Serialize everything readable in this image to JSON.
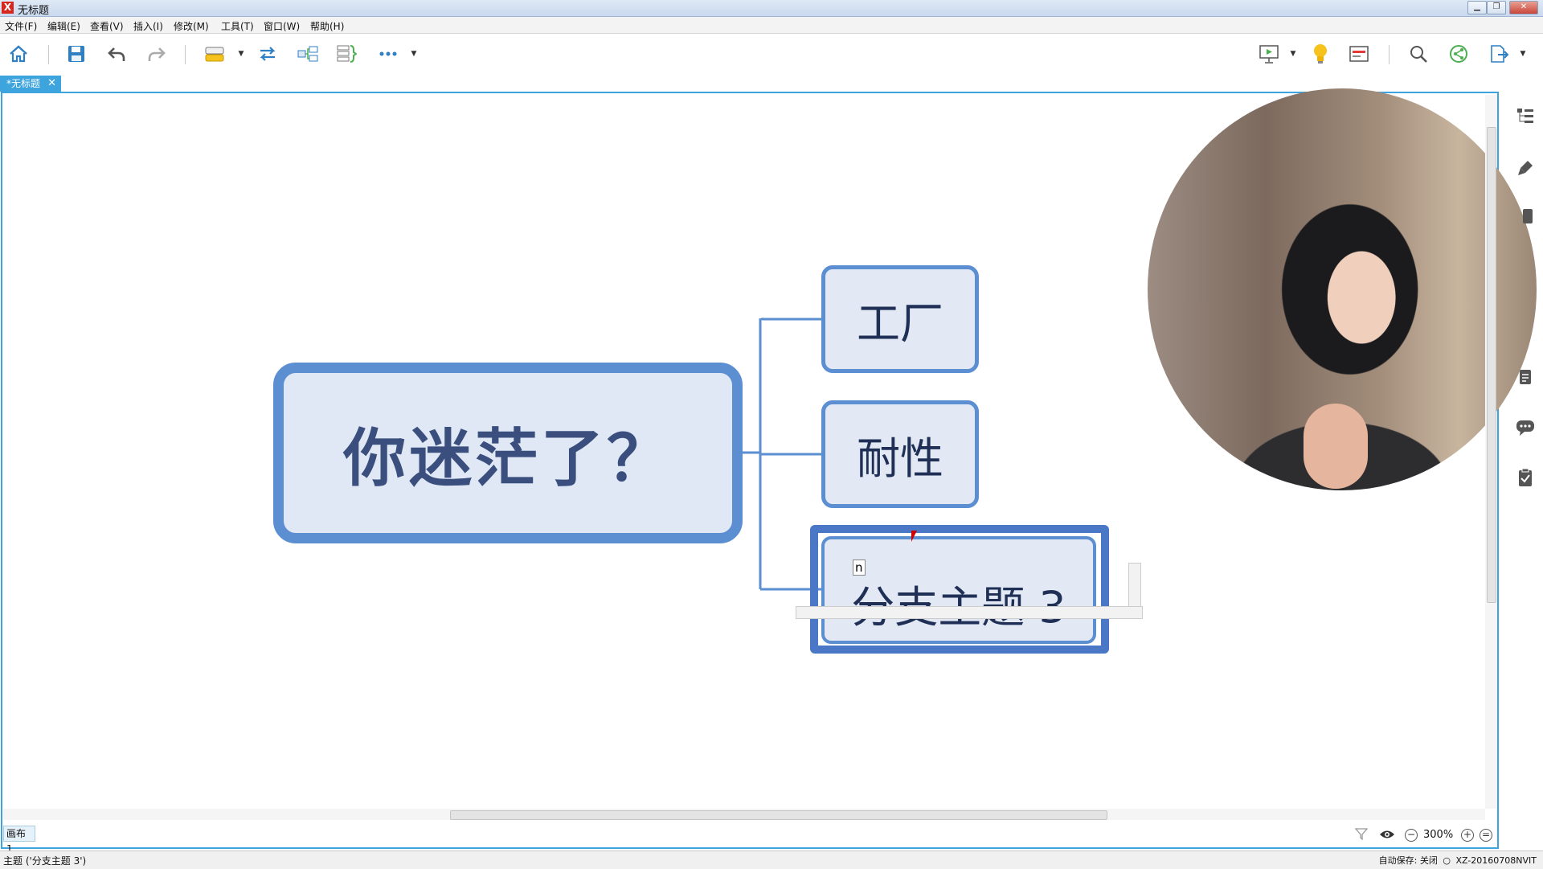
{
  "window": {
    "title": "无标题",
    "app_logo": "X",
    "controls": [
      "minimize",
      "restore",
      "close"
    ]
  },
  "menu": [
    "文件(F)",
    "编辑(E)",
    "查看(V)",
    "插入(I)",
    "修改(M)",
    "工具(T)",
    "窗口(W)",
    "帮助(H)"
  ],
  "toolbar": {
    "icons": [
      "home-icon",
      "save-icon",
      "undo-icon",
      "redo-icon",
      "topic-icon",
      "relationship-icon",
      "subtopic-icon",
      "summary-icon",
      "more-icon",
      "presentation-icon",
      "idea-icon",
      "outline-icon",
      "search-icon",
      "share-icon",
      "export-icon"
    ],
    "accent": "#3ea4dd"
  },
  "tab": {
    "label": "*无标题",
    "close": "✕"
  },
  "mindmap": {
    "central": "你迷茫了？",
    "branches": [
      "工厂",
      "耐性",
      "分支主题 3"
    ],
    "edit_caret_text": "n",
    "node_border_color": "#5c8ed2",
    "node_fill_color": "#e2e9f4"
  },
  "sheet_tab": "画布 1",
  "zoom": {
    "value": "300%"
  },
  "status": {
    "left": "主题 ('分支主题 3')",
    "autosave": "自动保存: 关闭",
    "machine": "XZ-20160708NVIT"
  }
}
